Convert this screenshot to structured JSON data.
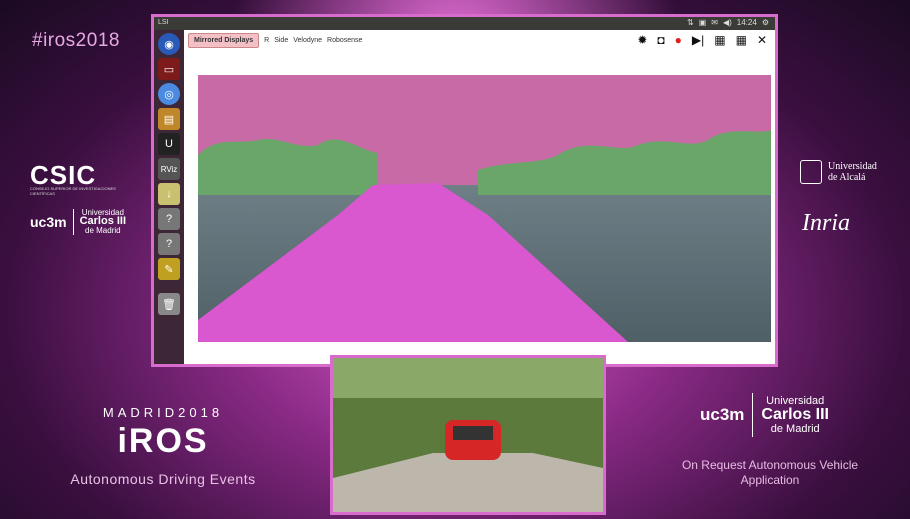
{
  "hashtag": "#iros2018",
  "left_logos": {
    "csic": "CSIC",
    "csic_sub": "CONSEJO SUPERIOR DE INVESTIGACIONES CIENTÍFICAS",
    "uc3m": "uc3m",
    "uc3m_line1": "Universidad",
    "uc3m_line2": "Carlos III",
    "uc3m_line3": "de Madrid"
  },
  "right_logos": {
    "alcala_line1": "Universidad",
    "alcala_line2": "de Alcalá",
    "inria": "Inria"
  },
  "event": {
    "top": "MADRID2018",
    "logo": "iROS",
    "subtitle": "Autonomous Driving Events"
  },
  "uc3m_right": {
    "u": "uc3m",
    "line1": "Universidad",
    "line2": "Carlos III",
    "line3": "de Madrid"
  },
  "app_description": "On Request Autonomous Vehicle Application",
  "desktop": {
    "window_title": "LSI",
    "clock": "14:24",
    "toolbar": {
      "mirrored_label": "Mirrored Displays",
      "tabs": [
        "R",
        "Side",
        "Velodyne",
        "Robosense"
      ]
    },
    "launcher_icons": [
      "ubuntu-icon",
      "terminal-icon",
      "chromium-icon",
      "files-icon",
      "matlab-icon",
      "rviz-icon",
      "installer-icon",
      "help-icon",
      "help-icon",
      "editor-icon",
      "trash-icon"
    ],
    "launcher_text": {
      "rviz": "RViz"
    },
    "colors": {
      "accent": "#d86ccd",
      "road": "#d958cf",
      "sky": "#c76aa6",
      "vegetation": "#6aa56a"
    }
  }
}
